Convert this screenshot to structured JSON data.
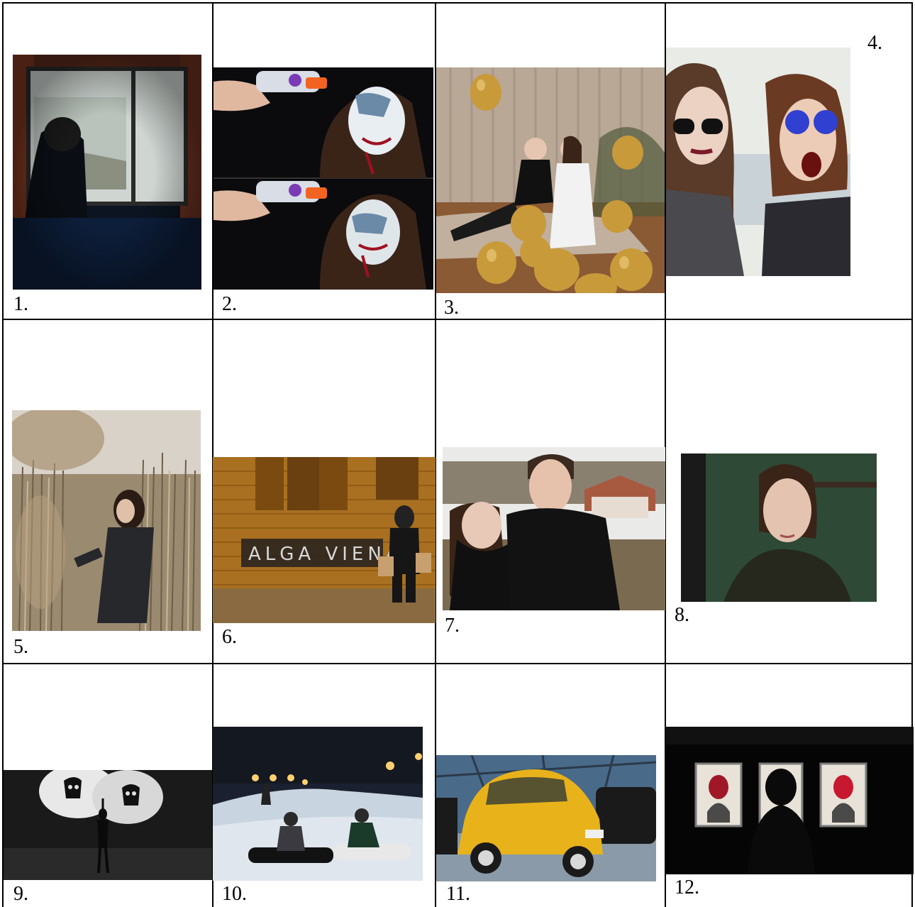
{
  "document": {
    "title": "",
    "photos": [
      {
        "label": "1.",
        "subject": "person-at-window-photo"
      },
      {
        "label": "2.",
        "subject": "zombie-makeup-water-gun-photo"
      },
      {
        "label": "3.",
        "subject": "gold-balloons-photo"
      },
      {
        "label": "4.",
        "subject": "sunglasses-selfie-photo"
      },
      {
        "label": "5.",
        "subject": "reeds-field-photo"
      },
      {
        "label": "6.",
        "subject": "wooden-wall-graffiti-photo"
      },
      {
        "label": "7.",
        "subject": "couple-outdoors-photo"
      },
      {
        "label": "8.",
        "subject": "green-room-portrait-photo"
      },
      {
        "label": "9.",
        "subject": "spotlight-masks-photo"
      },
      {
        "label": "10.",
        "subject": "night-snowboarding-photo"
      },
      {
        "label": "11.",
        "subject": "yellow-car-museum-photo"
      },
      {
        "label": "12.",
        "subject": "gallery-portraits-photo"
      }
    ]
  },
  "colors": {
    "border": "#000000",
    "background": "#ffffff",
    "gold": "#c89a3a",
    "yellow_car": "#e8b21a"
  }
}
